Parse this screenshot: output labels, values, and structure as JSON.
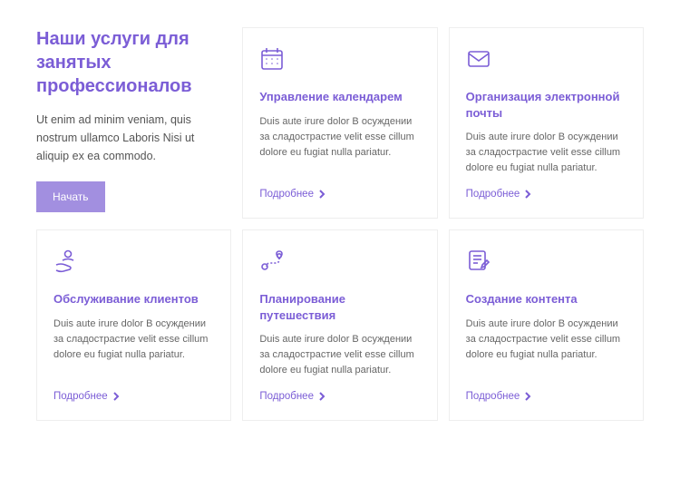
{
  "accent": "#7b5dd6",
  "intro": {
    "title": "Наши услуги для занятых профессионалов",
    "body": "Ut enim ad minim veniam, quis nostrum ullamco Laboris Nisi ut aliquip ex ea commodo.",
    "cta": "Начать"
  },
  "more_label": "Подробнее",
  "cards": [
    {
      "icon": "calendar",
      "title": "Управление календарем",
      "body": "Duis aute irure dolor В осуждении за сладострастие velit esse cillum dolore eu fugiat nulla pariatur."
    },
    {
      "icon": "envelope",
      "title": "Организация электронной почты",
      "body": "Duis aute irure dolor В осуждении за сладострастие velit esse cillum dolore eu fugiat nulla pariatur."
    },
    {
      "icon": "user-hand",
      "title": "Обслуживание клиентов",
      "body": "Duis aute irure dolor В осуждении за сладострастие velit esse cillum dolore eu fugiat nulla pariatur."
    },
    {
      "icon": "route",
      "title": "Планирование путешествия",
      "body": "Duis aute irure dolor В осуждении за сладострастие velit esse cillum dolore eu fugiat nulla pariatur."
    },
    {
      "icon": "document-edit",
      "title": "Создание контента",
      "body": "Duis aute irure dolor В осуждении за сладострастие velit esse cillum dolore eu fugiat nulla pariatur."
    }
  ]
}
